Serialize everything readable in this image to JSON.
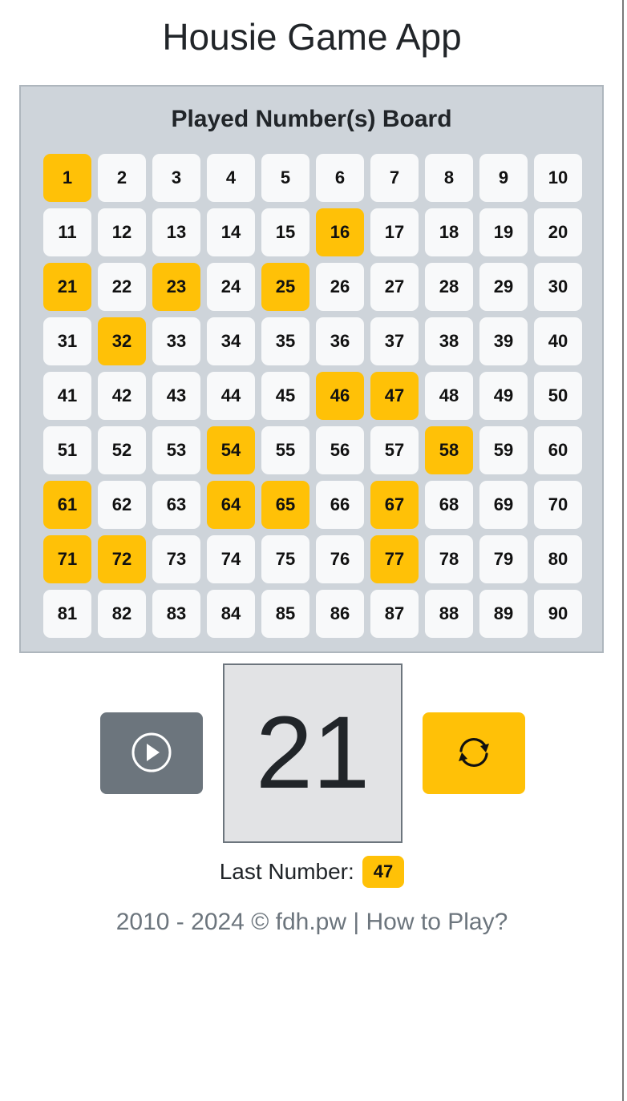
{
  "app": {
    "title": "Housie Game App"
  },
  "board": {
    "title": "Played Number(s) Board",
    "numbers": [
      {
        "n": "1",
        "played": true
      },
      {
        "n": "2",
        "played": false
      },
      {
        "n": "3",
        "played": false
      },
      {
        "n": "4",
        "played": false
      },
      {
        "n": "5",
        "played": false
      },
      {
        "n": "6",
        "played": false
      },
      {
        "n": "7",
        "played": false
      },
      {
        "n": "8",
        "played": false
      },
      {
        "n": "9",
        "played": false
      },
      {
        "n": "10",
        "played": false
      },
      {
        "n": "11",
        "played": false
      },
      {
        "n": "12",
        "played": false
      },
      {
        "n": "13",
        "played": false
      },
      {
        "n": "14",
        "played": false
      },
      {
        "n": "15",
        "played": false
      },
      {
        "n": "16",
        "played": true
      },
      {
        "n": "17",
        "played": false
      },
      {
        "n": "18",
        "played": false
      },
      {
        "n": "19",
        "played": false
      },
      {
        "n": "20",
        "played": false
      },
      {
        "n": "21",
        "played": true
      },
      {
        "n": "22",
        "played": false
      },
      {
        "n": "23",
        "played": true
      },
      {
        "n": "24",
        "played": false
      },
      {
        "n": "25",
        "played": true
      },
      {
        "n": "26",
        "played": false
      },
      {
        "n": "27",
        "played": false
      },
      {
        "n": "28",
        "played": false
      },
      {
        "n": "29",
        "played": false
      },
      {
        "n": "30",
        "played": false
      },
      {
        "n": "31",
        "played": false
      },
      {
        "n": "32",
        "played": true
      },
      {
        "n": "33",
        "played": false
      },
      {
        "n": "34",
        "played": false
      },
      {
        "n": "35",
        "played": false
      },
      {
        "n": "36",
        "played": false
      },
      {
        "n": "37",
        "played": false
      },
      {
        "n": "38",
        "played": false
      },
      {
        "n": "39",
        "played": false
      },
      {
        "n": "40",
        "played": false
      },
      {
        "n": "41",
        "played": false
      },
      {
        "n": "42",
        "played": false
      },
      {
        "n": "43",
        "played": false
      },
      {
        "n": "44",
        "played": false
      },
      {
        "n": "45",
        "played": false
      },
      {
        "n": "46",
        "played": true
      },
      {
        "n": "47",
        "played": true
      },
      {
        "n": "48",
        "played": false
      },
      {
        "n": "49",
        "played": false
      },
      {
        "n": "50",
        "played": false
      },
      {
        "n": "51",
        "played": false
      },
      {
        "n": "52",
        "played": false
      },
      {
        "n": "53",
        "played": false
      },
      {
        "n": "54",
        "played": true
      },
      {
        "n": "55",
        "played": false
      },
      {
        "n": "56",
        "played": false
      },
      {
        "n": "57",
        "played": false
      },
      {
        "n": "58",
        "played": true
      },
      {
        "n": "59",
        "played": false
      },
      {
        "n": "60",
        "played": false
      },
      {
        "n": "61",
        "played": true
      },
      {
        "n": "62",
        "played": false
      },
      {
        "n": "63",
        "played": false
      },
      {
        "n": "64",
        "played": true
      },
      {
        "n": "65",
        "played": true
      },
      {
        "n": "66",
        "played": false
      },
      {
        "n": "67",
        "played": true
      },
      {
        "n": "68",
        "played": false
      },
      {
        "n": "69",
        "played": false
      },
      {
        "n": "70",
        "played": false
      },
      {
        "n": "71",
        "played": true
      },
      {
        "n": "72",
        "played": true
      },
      {
        "n": "73",
        "played": false
      },
      {
        "n": "74",
        "played": false
      },
      {
        "n": "75",
        "played": false
      },
      {
        "n": "76",
        "played": false
      },
      {
        "n": "77",
        "played": true
      },
      {
        "n": "78",
        "played": false
      },
      {
        "n": "79",
        "played": false
      },
      {
        "n": "80",
        "played": false
      },
      {
        "n": "81",
        "played": false
      },
      {
        "n": "82",
        "played": false
      },
      {
        "n": "83",
        "played": false
      },
      {
        "n": "84",
        "played": false
      },
      {
        "n": "85",
        "played": false
      },
      {
        "n": "86",
        "played": false
      },
      {
        "n": "87",
        "played": false
      },
      {
        "n": "88",
        "played": false
      },
      {
        "n": "89",
        "played": false
      },
      {
        "n": "90",
        "played": false
      }
    ]
  },
  "controls": {
    "play_icon": "play-circle-icon",
    "reset_icon": "refresh-icon",
    "current_number": "21"
  },
  "last": {
    "label": "Last Number:",
    "value": "47"
  },
  "footer": {
    "copyright": "2010 - 2024 © fdh.pw",
    "separator": " | ",
    "help_link": "How to Play?"
  },
  "colors": {
    "played": "#ffc107",
    "unplayed": "#f8f9fa",
    "board_bg": "#ced4da",
    "play_button": "#6c757d",
    "reset_button": "#ffc107",
    "current_box": "#e2e3e5"
  }
}
